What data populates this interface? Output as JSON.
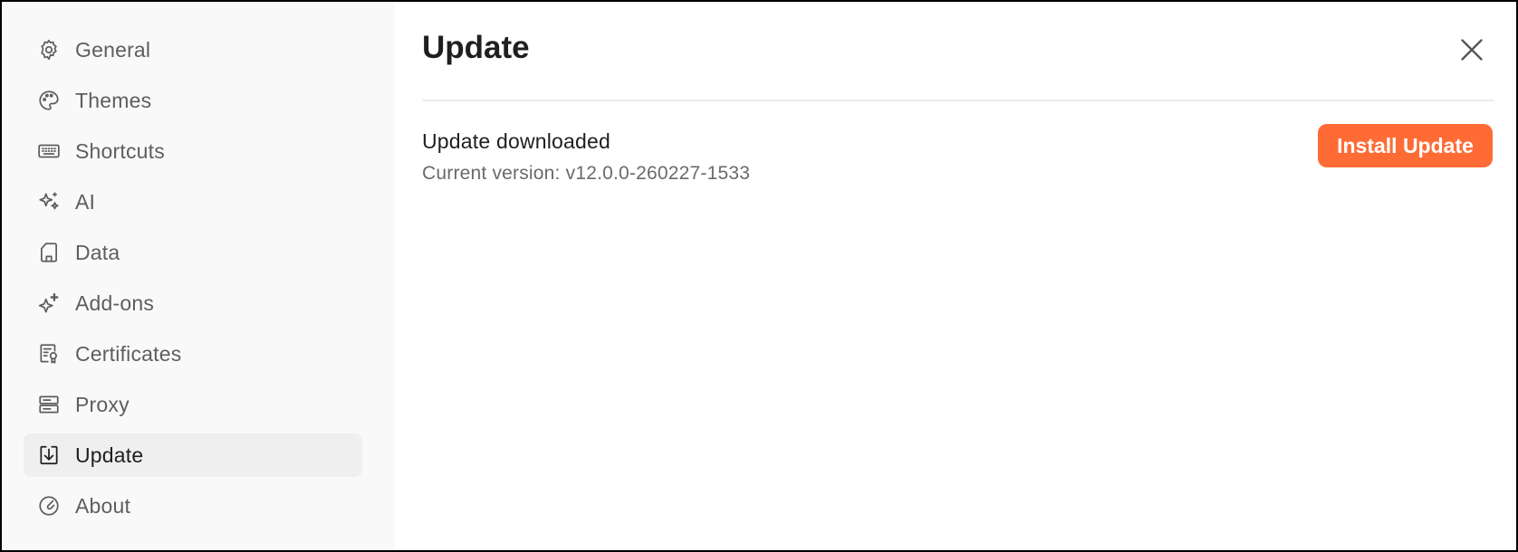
{
  "sidebar": {
    "items": [
      {
        "label": "General",
        "icon": "gear-icon",
        "active": false
      },
      {
        "label": "Themes",
        "icon": "palette-icon",
        "active": false
      },
      {
        "label": "Shortcuts",
        "icon": "keyboard-icon",
        "active": false
      },
      {
        "label": "AI",
        "icon": "sparkles-icon",
        "active": false
      },
      {
        "label": "Data",
        "icon": "sd-card-icon",
        "active": false
      },
      {
        "label": "Add-ons",
        "icon": "sparkle-plus-icon",
        "active": false
      },
      {
        "label": "Certificates",
        "icon": "certificate-icon",
        "active": false
      },
      {
        "label": "Proxy",
        "icon": "server-icon",
        "active": false
      },
      {
        "label": "Update",
        "icon": "download-icon",
        "active": true
      },
      {
        "label": "About",
        "icon": "about-icon",
        "active": false
      }
    ]
  },
  "main": {
    "title": "Update",
    "close_icon": "close-icon",
    "status_title": "Update downloaded",
    "version_text": "Current version: v12.0.0-260227-1533",
    "install_button_label": "Install Update"
  },
  "colors": {
    "accent": "#ff6b35",
    "sidebar_bg": "#f9f9f9",
    "active_item_bg": "#efefef"
  }
}
